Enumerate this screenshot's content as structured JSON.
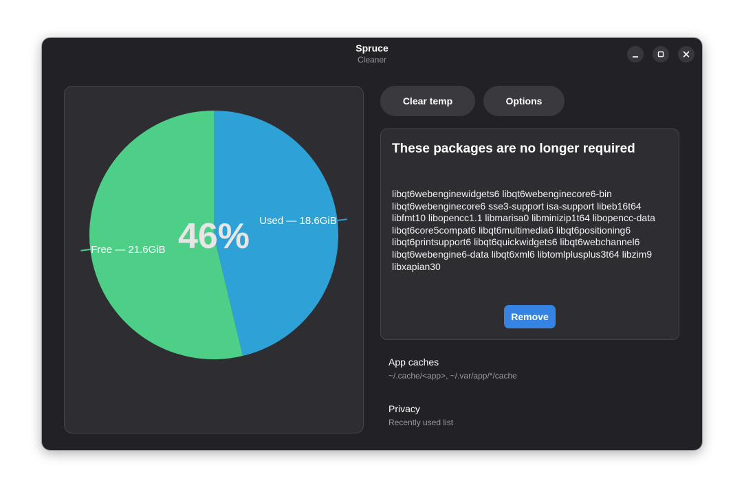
{
  "window": {
    "title": "Spruce",
    "subtitle": "Cleaner"
  },
  "toolbar": {
    "clear_temp_label": "Clear temp",
    "options_label": "Options"
  },
  "chart_data": {
    "type": "pie",
    "center_label": "46%",
    "slices": [
      {
        "label": "Used — 18.6GiB",
        "value": 18.6,
        "color": "#2ea1d7"
      },
      {
        "label": "Free — 21.6GiB",
        "value": 21.6,
        "color": "#4ecf87"
      }
    ]
  },
  "packages": {
    "heading": "These packages are no longer required",
    "list_text": "libqt6webenginewidgets6 libqt6webenginecore6-bin libqt6webenginecore6 sse3-support isa-support libeb16t64 libfmt10 libopencc1.1 libmarisa0 libminizip1t64 libopencc-data libqt6core5compat6 libqt6multimedia6 libqt6positioning6 libqt6printsupport6 libqt6quickwidgets6 libqt6webchannel6 libqt6webengine6-data libqt6xml6 libtomlplusplus3t64 libzim9 libxapian30",
    "remove_label": "Remove"
  },
  "rows": {
    "caches_title": "App caches",
    "caches_subtitle": "~/.cache/<app>, ~/.var/app/*/cache",
    "privacy_title": "Privacy",
    "privacy_subtitle": "Recently used list"
  },
  "icons": {
    "minimize": "minimize-icon",
    "maximize": "maximize-icon",
    "close": "close-icon"
  }
}
